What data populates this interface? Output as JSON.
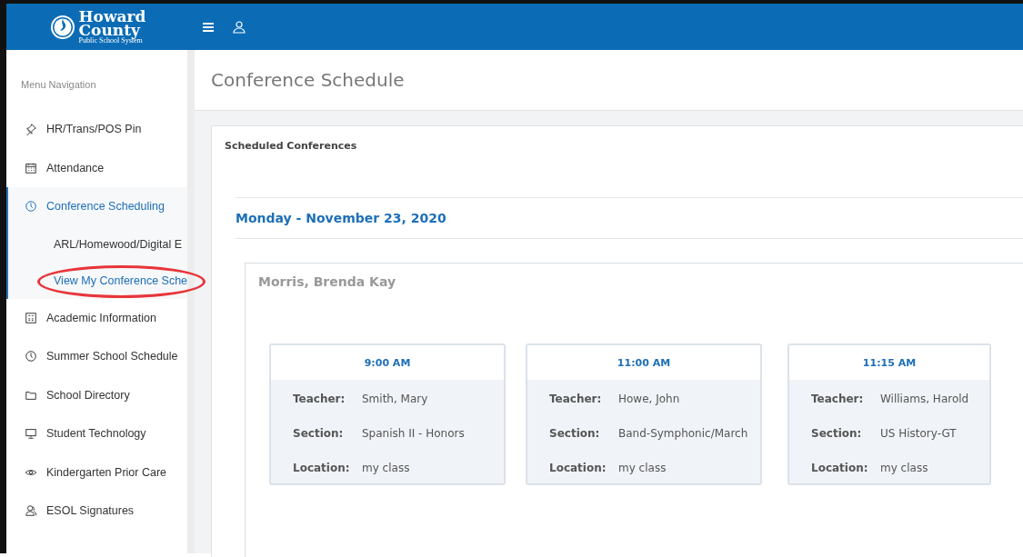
{
  "header": {
    "logo": {
      "line_1": "Howard",
      "line_2": "County",
      "tagline": "Public School System"
    }
  },
  "sidebar": {
    "heading": "Menu Navigation",
    "items": [
      {
        "label": "HR/Trans/POS Pin",
        "expanded": false
      },
      {
        "label": "Attendance",
        "expanded": false
      },
      {
        "label": "Conference Scheduling",
        "expanded": true,
        "children": [
          {
            "label": "ARL/Homewood/Digital E",
            "selected": false,
            "circled": false
          },
          {
            "label": "View My Conference Sche",
            "selected": true,
            "circled": true
          }
        ]
      },
      {
        "label": "Academic Information",
        "expanded": false
      },
      {
        "label": "Summer School Schedule",
        "expanded": false
      },
      {
        "label": "School Directory",
        "expanded": false
      },
      {
        "label": "Student Technology",
        "expanded": false
      },
      {
        "label": "Kindergarten Prior Care",
        "expanded": false
      },
      {
        "label": "ESOL Signatures",
        "expanded": false
      }
    ]
  },
  "page": {
    "title": "Conference Schedule",
    "panel_title": "Scheduled Conferences",
    "date": "Monday - November 23, 2020",
    "student": "Morris, Brenda Kay",
    "conferences": [
      {
        "time": "9:00 AM",
        "fields": [
          {
            "label": "Teacher:",
            "value": "Smith, Mary"
          },
          {
            "label": "Section:",
            "value": "Spanish II - Honors"
          },
          {
            "label": "Location:",
            "value": "my class"
          }
        ]
      },
      {
        "time": "11:00 AM",
        "fields": [
          {
            "label": "Teacher:",
            "value": "Howe, John"
          },
          {
            "label": "Section:",
            "value": "Band-Symphonic/March"
          },
          {
            "label": "Location:",
            "value": "my class"
          }
        ]
      },
      {
        "time": "11:15 AM",
        "fields": [
          {
            "label": "Teacher:",
            "value": "Williams, Harold"
          },
          {
            "label": "Section:",
            "value": "US History-GT"
          },
          {
            "label": "Location:",
            "value": "my class"
          }
        ]
      }
    ]
  }
}
